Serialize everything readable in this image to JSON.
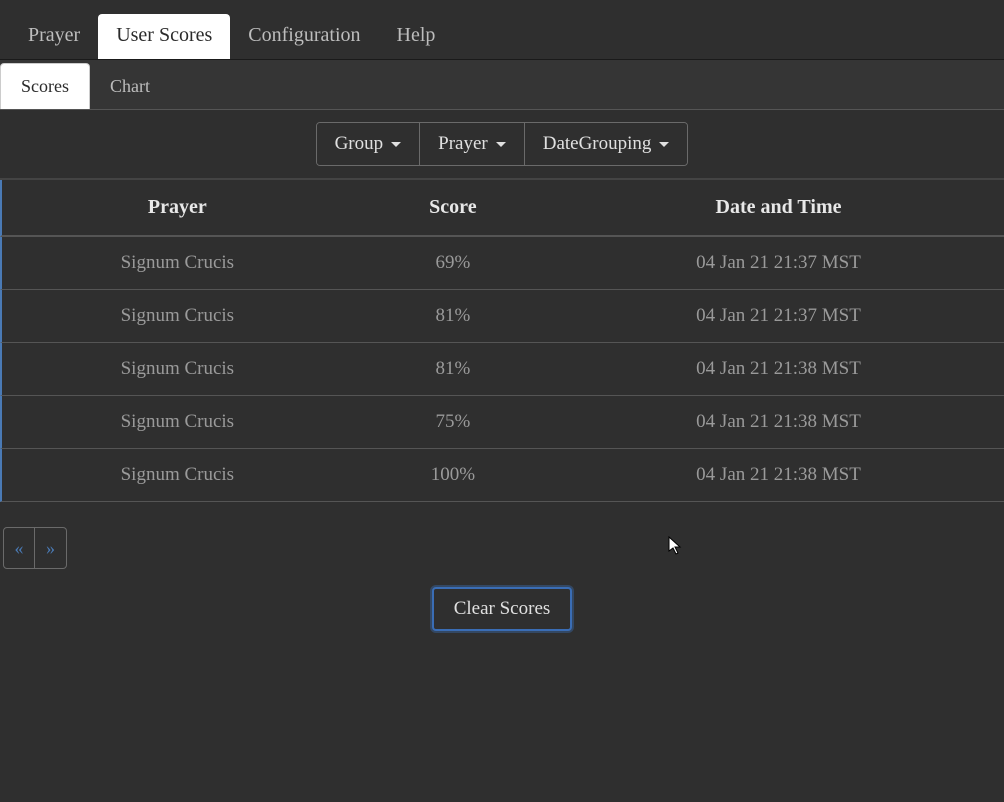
{
  "mainTabs": {
    "prayer": "Prayer",
    "userScores": "User Scores",
    "configuration": "Configuration",
    "help": "Help"
  },
  "subTabs": {
    "scores": "Scores",
    "chart": "Chart"
  },
  "filters": {
    "group": "Group",
    "prayer": "Prayer",
    "dateGrouping": "DateGrouping"
  },
  "table": {
    "headers": {
      "prayer": "Prayer",
      "score": "Score",
      "datetime": "Date and Time"
    },
    "rows": [
      {
        "prayer": "Signum Crucis",
        "score": "69%",
        "datetime": "04 Jan 21 21:37 MST"
      },
      {
        "prayer": "Signum Crucis",
        "score": "81%",
        "datetime": "04 Jan 21 21:37 MST"
      },
      {
        "prayer": "Signum Crucis",
        "score": "81%",
        "datetime": "04 Jan 21 21:38 MST"
      },
      {
        "prayer": "Signum Crucis",
        "score": "75%",
        "datetime": "04 Jan 21 21:38 MST"
      },
      {
        "prayer": "Signum Crucis",
        "score": "100%",
        "datetime": "04 Jan 21 21:38 MST"
      }
    ]
  },
  "pagination": {
    "prev": "«",
    "next": "»"
  },
  "actions": {
    "clearScores": "Clear Scores"
  }
}
